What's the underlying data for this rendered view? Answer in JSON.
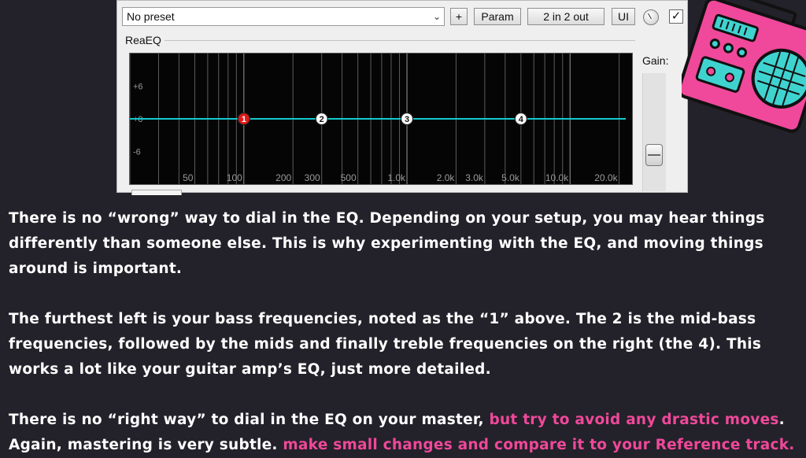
{
  "plugin": {
    "preset": "No preset",
    "add_button": "+",
    "param_button": "Param",
    "io_button": "2 in 2 out",
    "ui_button": "UI",
    "enabled_checked": true,
    "section_label": "ReaEQ",
    "gain_label": "Gain:"
  },
  "eq": {
    "db_labels": [
      "+6",
      "+0",
      "-6"
    ],
    "freq_labels": [
      "50",
      "100",
      "200",
      "300",
      "500",
      "1.0k",
      "2.0k",
      "3.0k",
      "5.0k",
      "10.0k",
      "20.0k"
    ],
    "bands": [
      {
        "label": "1",
        "freq_hz": 100,
        "gain_db": 0,
        "selected": true
      },
      {
        "label": "2",
        "freq_hz": 300,
        "gain_db": 0,
        "selected": false
      },
      {
        "label": "3",
        "freq_hz": 1000,
        "gain_db": 0,
        "selected": false
      },
      {
        "label": "4",
        "freq_hz": 5000,
        "gain_db": 0,
        "selected": false
      }
    ],
    "freq_range": [
      20,
      24000
    ],
    "db_range": [
      -12,
      12
    ],
    "curve_color": "#13c8cf",
    "selected_color": "#e01818"
  },
  "article": {
    "p1": "There is no “wrong” way to dial in the EQ. Depending on your setup, you may hear things differently than someone else. This is why experimenting with the EQ, and moving things around is important.",
    "p2": "The furthest left is your bass frequencies, noted as the “1” above. The 2 is the mid-bass frequencies, followed by the mids and finally treble frequencies on the right (the 4). This works a lot like your guitar amp’s EQ, just more detailed.",
    "p3_a": "There is no “right way” to dial in the EQ on your master, ",
    "p3_b": "but try to avoid any drastic moves",
    "p3_c": ". Again, mastering is very subtle. ",
    "p3_d": "make small changes and compare it to your Reference track.",
    "accent_color": "#f0489a"
  },
  "colors": {
    "background": "#23222a",
    "boombox_pink": "#f0489a",
    "boombox_teal": "#3fd3d0"
  }
}
